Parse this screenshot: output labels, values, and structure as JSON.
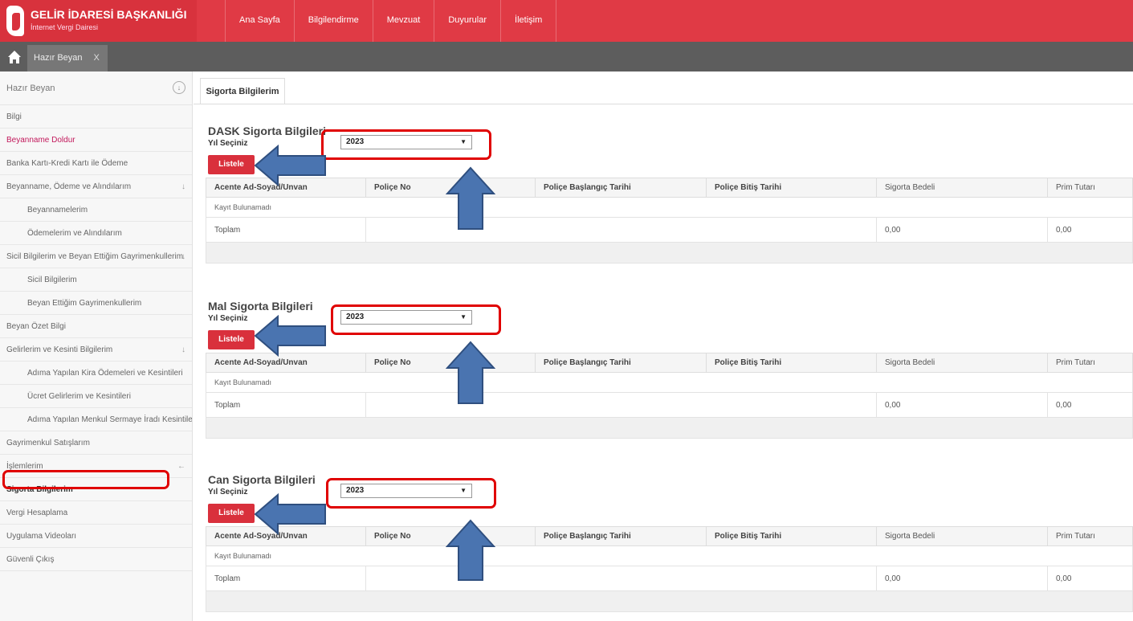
{
  "header": {
    "org_title": "GELİR İDARESİ BAŞKANLIĞI",
    "org_subtitle": "İnternet Vergi Dairesi",
    "nav": [
      "Ana Sayfa",
      "Bilgilendirme",
      "Mevzuat",
      "Duyurular",
      "İletişim"
    ]
  },
  "tabstrip": {
    "open_tab": "Hazır Beyan",
    "close": "X"
  },
  "sidebar": {
    "heading": "Hazır Beyan",
    "heading_btn": "↓",
    "items": [
      {
        "label": "Bilgi"
      },
      {
        "label": "Beyanname Doldur"
      },
      {
        "label": "Banka Kartı-Kredi Kartı ile Ödeme"
      },
      {
        "label": "Beyanname, Ödeme ve Alındılarım",
        "exp": "↓"
      },
      {
        "label": "Beyannamelerim"
      },
      {
        "label": "Ödemelerim ve Alındılarım"
      },
      {
        "label": "Sicil Bilgilerim ve Beyan Ettiğim Gayrimenkullerim",
        "exp": "↓"
      },
      {
        "label": "Sicil Bilgilerim"
      },
      {
        "label": "Beyan Ettiğim Gayrimenkullerim"
      },
      {
        "label": "Beyan Özet Bilgi"
      },
      {
        "label": "Gelirlerim ve Kesinti Bilgilerim",
        "exp": "↓"
      },
      {
        "label": "Adıma Yapılan Kira Ödemeleri ve Kesintileri"
      },
      {
        "label": "Ücret Gelirlerim ve Kesintileri"
      },
      {
        "label": "Adıma Yapılan Menkul Sermaye İradı Kesintileri"
      },
      {
        "label": "Gayrimenkul Satışlarım"
      },
      {
        "label": "İşlemlerim",
        "exp": "←"
      },
      {
        "label": "Sigorta Bilgilerim"
      },
      {
        "label": "Vergi Hesaplama"
      },
      {
        "label": "Uygulama Videoları"
      },
      {
        "label": "Güvenli Çıkış"
      }
    ]
  },
  "main": {
    "tab": "Sigorta Bilgilerim",
    "year_label": "Yıl Seçiniz",
    "list_btn": "Listele",
    "columns": [
      "Acente Ad-Soyad/Unvan",
      "Poliçe No",
      "Poliçe Başlangıç Tarihi",
      "Poliçe Bitiş Tarihi",
      "Sigorta Bedeli",
      "Prim Tutarı"
    ],
    "empty_text": "Kayıt Bulunamadı",
    "total_label": "Toplam",
    "sections": [
      {
        "title": "DASK Sigorta Bilgileri",
        "year": "2023",
        "sum_value": "0,00",
        "prim_value": "0,00"
      },
      {
        "title": "Mal Sigorta Bilgileri",
        "year": "2023",
        "sum_value": "0,00",
        "prim_value": "0,00"
      },
      {
        "title": "Can Sigorta Bilgileri",
        "year": "2023",
        "sum_value": "0,00",
        "prim_value": "0,00"
      }
    ]
  },
  "colors": {
    "brand_red": "#e03a45",
    "button_red": "#d9303c",
    "annotation_red": "#e00000",
    "arrow_blue": "#4a74b0"
  },
  "icons": {
    "home": "home-icon",
    "arrow": "callout-arrow"
  }
}
